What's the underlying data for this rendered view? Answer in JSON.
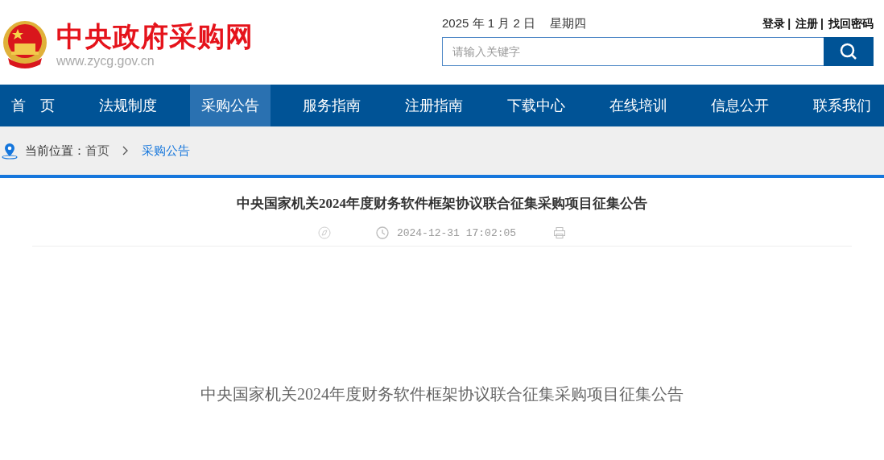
{
  "header": {
    "site_title": "中央政府采购网",
    "site_url": "www.zycg.gov.cn",
    "date": "2025 年 1 月 2 日",
    "weekday": "星期四",
    "account_links": [
      "登录",
      "注册",
      "找回密码"
    ],
    "link_separator": "|",
    "search": {
      "placeholder": "请输入关键字"
    }
  },
  "nav": [
    {
      "label": "首　页",
      "selected": false
    },
    {
      "label": "法规制度",
      "selected": false
    },
    {
      "label": "采购公告",
      "selected": true
    },
    {
      "label": "服务指南",
      "selected": false
    },
    {
      "label": "注册指南",
      "selected": false
    },
    {
      "label": "下载中心",
      "selected": false
    },
    {
      "label": "在线培训",
      "selected": false
    },
    {
      "label": "信息公开",
      "selected": false
    },
    {
      "label": "联系我们",
      "selected": false
    }
  ],
  "breadcrumb": {
    "label": "当前位置：",
    "items": [
      {
        "label": "首页",
        "selected": false
      },
      {
        "label": "采购公告",
        "selected": true
      }
    ]
  },
  "article": {
    "title": "中央国家机关2024年度财务软件框架协议联合征集采购项目征集公告",
    "timestamp": "2024-12-31 17:02:05",
    "body": "中央国家机关2024年度财务软件框架协议联合征集采购项目征集公告"
  }
}
